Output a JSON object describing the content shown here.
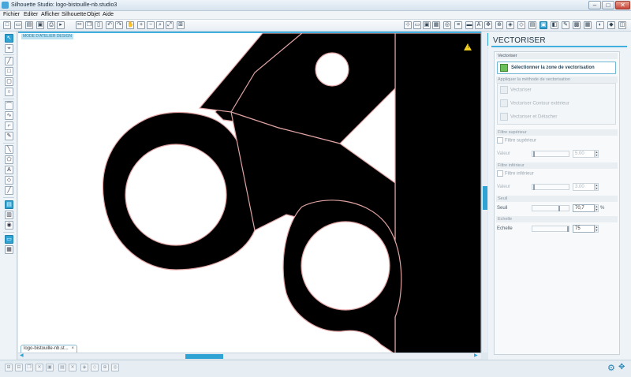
{
  "window": {
    "title": "Silhouette Studio: logo-bistouille-nb.studio3",
    "buttons": {
      "minimize": "–",
      "maximize": "□",
      "close": "✕"
    }
  },
  "menu": {
    "items": [
      "Fichier",
      "Editer",
      "Afficher",
      "Silhouette",
      "Objet",
      "Aide"
    ]
  },
  "canvas": {
    "mode_label": "MODE D'ATELIER DESIGN",
    "warning_mark": "!"
  },
  "document_tab": {
    "label": "logo-bistouille-nb.st...",
    "close": "×"
  },
  "panel": {
    "title": "VECTORISER",
    "section_vectoriser": "Vectoriser",
    "select_zone_label": "Sélectionner la zone de vectorisation",
    "section_method": "Appliquer la méthode de vectorisation",
    "method_items": [
      "Vectoriser",
      "Vectoriser Contour extérieur",
      "Vectoriser et Détacher"
    ],
    "section_filtre_sup": "Filtre supérieur",
    "filtre_sup_label": "Filtre supérieur",
    "filtre_sup_value_label": "Valeur",
    "filtre_sup_value": "5.00",
    "section_filtre_inf": "Filtre inférieur",
    "filtre_inf_label": "Filtre inférieur",
    "filtre_inf_value_label": "Valeur",
    "filtre_inf_value": "3.00",
    "section_seuil": "Seuil",
    "seuil_label": "Seuil",
    "seuil_value": "70,7",
    "seuil_unit": "%",
    "section_echelle": "Echelle",
    "echelle_label": "Echelle",
    "echelle_value": "75"
  },
  "colors": {
    "accent": "#2fa3d3",
    "image_fill": "#000000",
    "trace_outline": "#e0a3a3"
  }
}
